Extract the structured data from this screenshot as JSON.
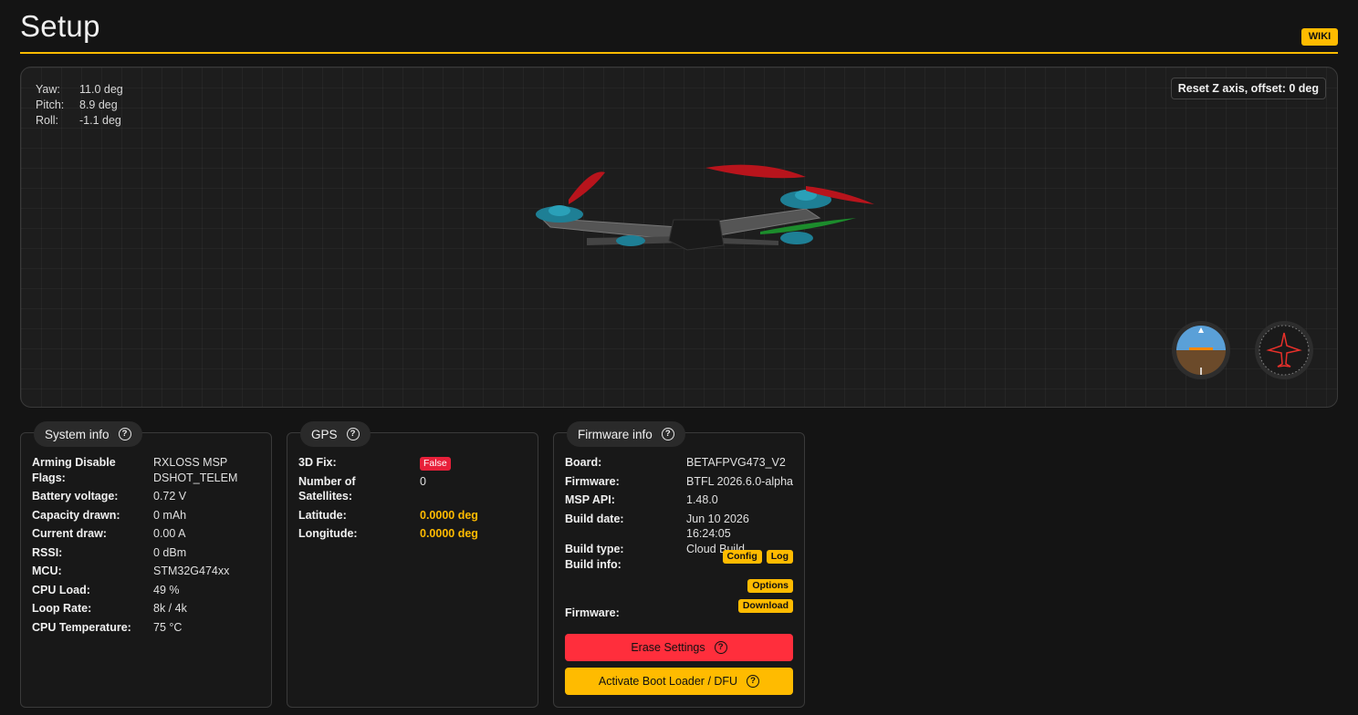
{
  "header": {
    "title": "Setup",
    "wiki_label": "WIKI"
  },
  "viewer": {
    "yaw_label": "Yaw:",
    "yaw_value": "11.0 deg",
    "pitch_label": "Pitch:",
    "pitch_value": "8.9 deg",
    "roll_label": "Roll:",
    "roll_value": "-1.1 deg",
    "reset_label": "Reset Z axis, offset: 0 deg"
  },
  "system_info": {
    "title": "System info",
    "rows": [
      {
        "k": "Arming Disable Flags:",
        "v": "RXLOSS  MSP DSHOT_TELEM"
      },
      {
        "k": "Battery voltage:",
        "v": "0.72 V"
      },
      {
        "k": "Capacity drawn:",
        "v": "0 mAh"
      },
      {
        "k": "Current draw:",
        "v": "0.00 A"
      },
      {
        "k": "RSSI:",
        "v": "0 dBm"
      },
      {
        "k": "MCU:",
        "v": "STM32G474xx"
      },
      {
        "k": "CPU Load:",
        "v": "49 %"
      },
      {
        "k": "Loop Rate:",
        "v": "8k / 4k"
      },
      {
        "k": "CPU Temperature:",
        "v": "75 °C"
      }
    ]
  },
  "gps": {
    "title": "GPS",
    "fix_label": "3D Fix:",
    "fix_value": "False",
    "sats_label": "Number of Satellites:",
    "sats_value": "0",
    "lat_label": "Latitude:",
    "lat_value": "0.0000 deg",
    "lon_label": "Longitude:",
    "lon_value": "0.0000 deg"
  },
  "firmware_info": {
    "title": "Firmware info",
    "rows": [
      {
        "k": "Board:",
        "v": "BETAFPVG473_V2"
      },
      {
        "k": "Firmware:",
        "v": "BTFL 2026.6.0-alpha"
      },
      {
        "k": "MSP API:",
        "v": "1.48.0"
      },
      {
        "k": "Build date:",
        "v": "Jun 10 2026 16:24:05"
      },
      {
        "k": "Build type:",
        "v": "Cloud Build"
      }
    ],
    "build_info_label": "Build info:",
    "config_label": "Config",
    "log_label": "Log",
    "options_label": "Options",
    "firmware_label": "Firmware:",
    "download_label": "Download",
    "erase_label": "Erase Settings",
    "bootloader_label": "Activate Boot Loader / DFU"
  },
  "colors": {
    "accent": "#ffbb00",
    "danger": "#ff2e3c",
    "background": "#141414"
  },
  "icons": [
    "help-icon",
    "attitude-indicator-icon",
    "heading-indicator-icon",
    "quadcopter-model"
  ]
}
